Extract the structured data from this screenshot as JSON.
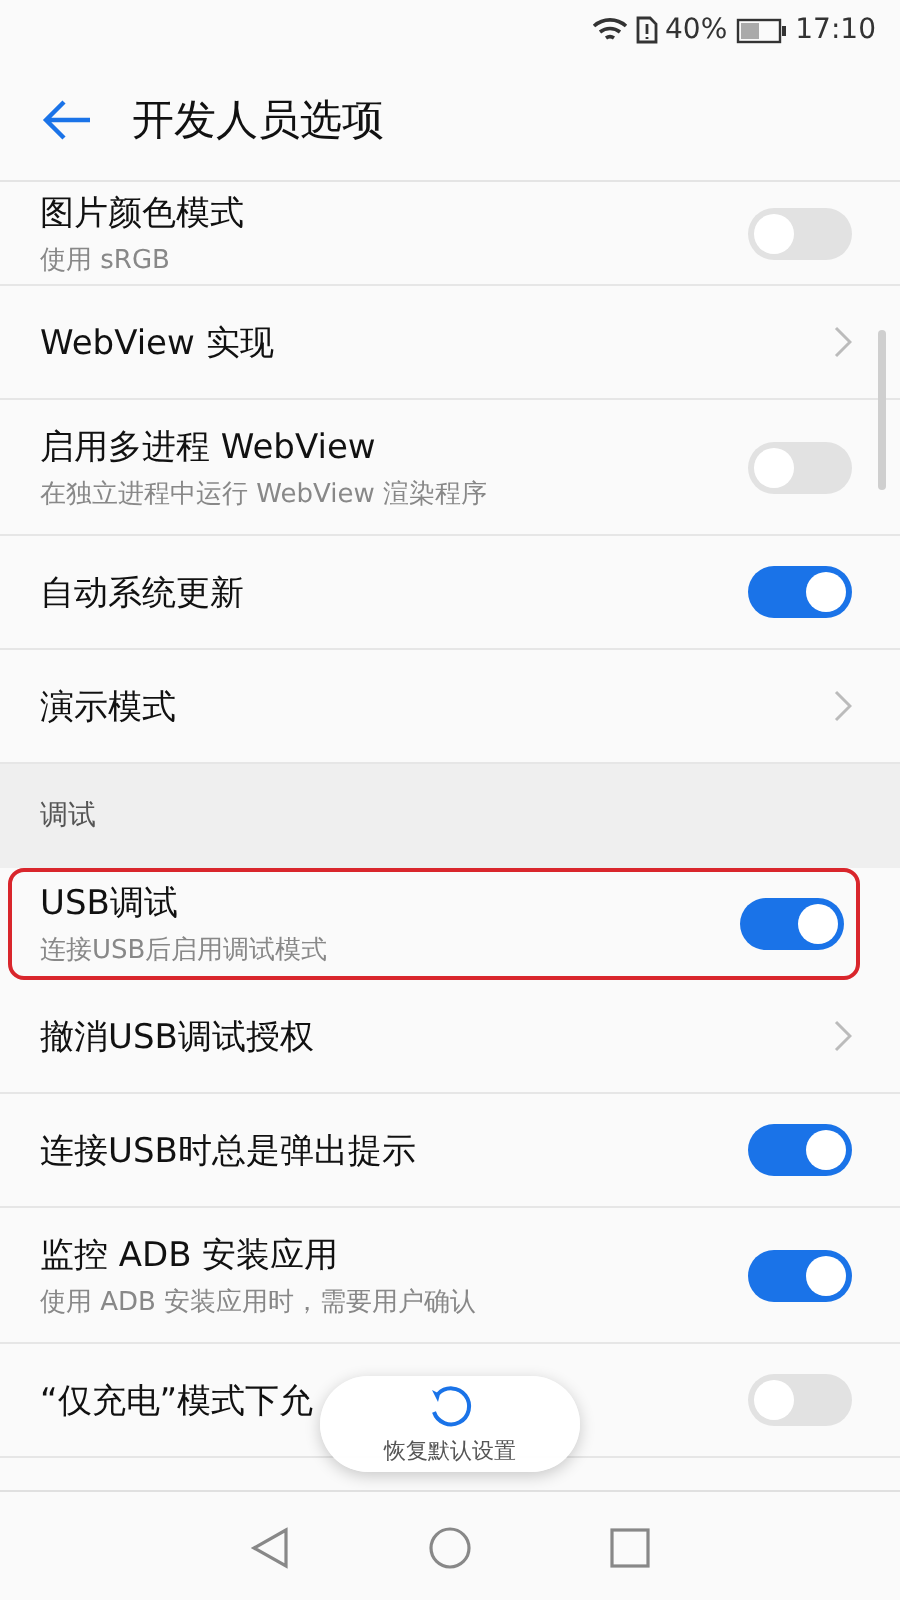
{
  "status_bar": {
    "battery_percent": "40%",
    "time": "17:10"
  },
  "header": {
    "title": "开发人员选项"
  },
  "items": [
    {
      "kind": "toggle",
      "title": "图片颜色模式",
      "subtitle": "使用 sRGB",
      "on": false,
      "highlighted": false
    },
    {
      "kind": "link",
      "title": "WebView 实现",
      "highlighted": false
    },
    {
      "kind": "toggle",
      "title": "启用多进程 WebView",
      "subtitle": "在独立进程中运行 WebView 渲染程序",
      "on": false,
      "highlighted": false
    },
    {
      "kind": "toggle",
      "title": "自动系统更新",
      "on": true,
      "highlighted": false
    },
    {
      "kind": "link",
      "title": "演示模式",
      "highlighted": false
    },
    {
      "kind": "section",
      "title": "调试"
    },
    {
      "kind": "toggle",
      "title": "USB调试",
      "subtitle": "连接USB后启用调试模式",
      "on": true,
      "highlighted": true
    },
    {
      "kind": "link",
      "title": "撤消USB调试授权",
      "highlighted": false
    },
    {
      "kind": "toggle",
      "title": "连接USB时总是弹出提示",
      "on": true,
      "highlighted": false
    },
    {
      "kind": "toggle",
      "title": "监控 ADB 安装应用",
      "subtitle": "使用 ADB 安装应用时，需要用户确认",
      "on": true,
      "highlighted": false
    },
    {
      "kind": "toggle",
      "title": "“仅充电”模式下允",
      "on": false,
      "highlighted": false
    }
  ],
  "floating_button": {
    "label": "恢复默认设置"
  }
}
